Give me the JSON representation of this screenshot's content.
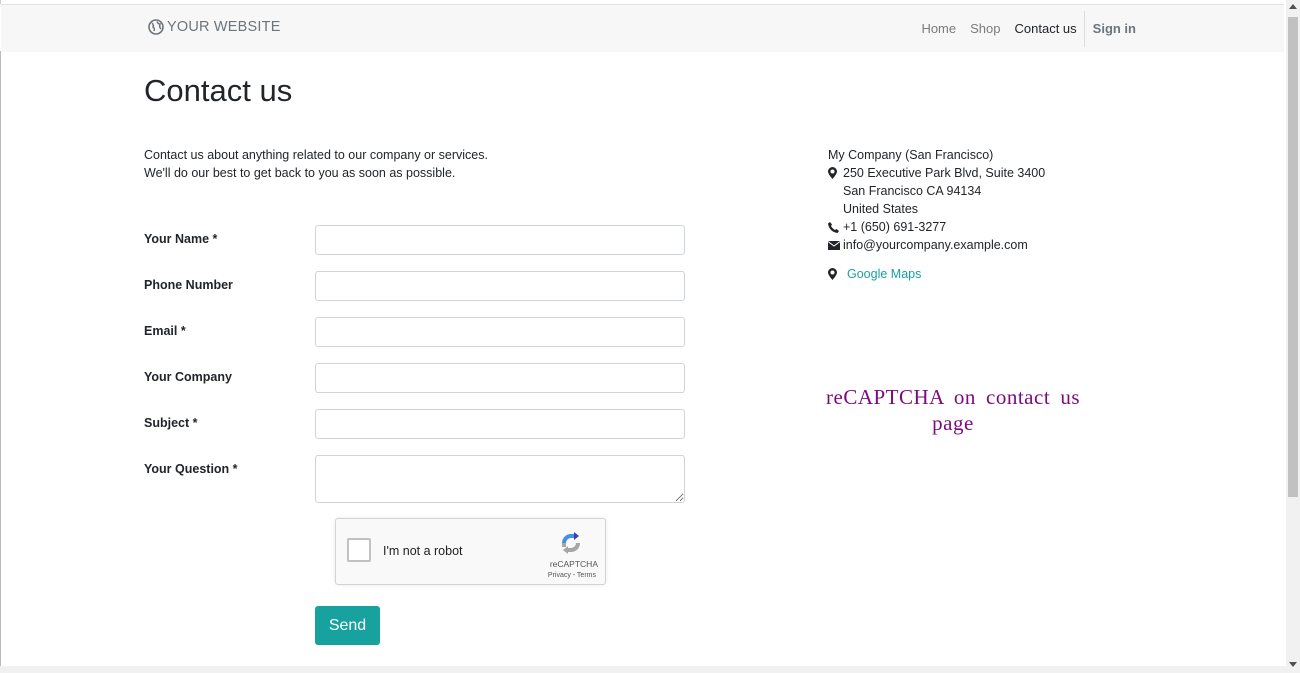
{
  "header": {
    "brand": "YOUR WEBSITE",
    "nav": [
      {
        "label": "Home"
      },
      {
        "label": "Shop"
      },
      {
        "label": "Contact us"
      }
    ],
    "sign_in": "Sign in"
  },
  "page": {
    "title": "Contact us",
    "intro_line1": "Contact us about anything related to our company or services.",
    "intro_line2": "We'll do our best to get back to you as soon as possible."
  },
  "form": {
    "fields": [
      {
        "label": "Your Name *",
        "value": ""
      },
      {
        "label": "Phone Number",
        "value": ""
      },
      {
        "label": "Email *",
        "value": ""
      },
      {
        "label": "Your Company",
        "value": ""
      },
      {
        "label": "Subject *",
        "value": ""
      },
      {
        "label": "Your Question *",
        "value": ""
      }
    ],
    "captcha": {
      "label": "I'm not a robot",
      "brand": "reCAPTCHA",
      "links": "Privacy - Terms"
    },
    "send_label": "Send"
  },
  "company": {
    "name": "My Company (San Francisco)",
    "address_line1": "250 Executive Park Blvd, Suite 3400",
    "address_line2": "San Francisco CA 94134",
    "address_line3": "United States",
    "phone": "+1 (650) 691-3277",
    "email": "info@yourcompany.example.com",
    "maps_link": "Google Maps"
  },
  "annotation": "reCAPTCHA on contact us page",
  "colors": {
    "accent": "#17a2a0",
    "annotation": "#7b0b7d",
    "navbar_bg": "#f7f7f7"
  }
}
